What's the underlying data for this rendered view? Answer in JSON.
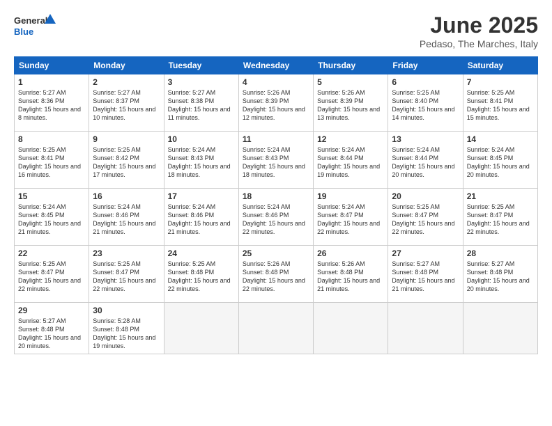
{
  "logo": {
    "line1": "General",
    "line2": "Blue"
  },
  "header": {
    "title": "June 2025",
    "subtitle": "Pedaso, The Marches, Italy"
  },
  "weekdays": [
    "Sunday",
    "Monday",
    "Tuesday",
    "Wednesday",
    "Thursday",
    "Friday",
    "Saturday"
  ],
  "weeks": [
    [
      {
        "day": "1",
        "sunrise": "Sunrise: 5:27 AM",
        "sunset": "Sunset: 8:36 PM",
        "daylight": "Daylight: 15 hours and 8 minutes."
      },
      {
        "day": "2",
        "sunrise": "Sunrise: 5:27 AM",
        "sunset": "Sunset: 8:37 PM",
        "daylight": "Daylight: 15 hours and 10 minutes."
      },
      {
        "day": "3",
        "sunrise": "Sunrise: 5:27 AM",
        "sunset": "Sunset: 8:38 PM",
        "daylight": "Daylight: 15 hours and 11 minutes."
      },
      {
        "day": "4",
        "sunrise": "Sunrise: 5:26 AM",
        "sunset": "Sunset: 8:39 PM",
        "daylight": "Daylight: 15 hours and 12 minutes."
      },
      {
        "day": "5",
        "sunrise": "Sunrise: 5:26 AM",
        "sunset": "Sunset: 8:39 PM",
        "daylight": "Daylight: 15 hours and 13 minutes."
      },
      {
        "day": "6",
        "sunrise": "Sunrise: 5:25 AM",
        "sunset": "Sunset: 8:40 PM",
        "daylight": "Daylight: 15 hours and 14 minutes."
      },
      {
        "day": "7",
        "sunrise": "Sunrise: 5:25 AM",
        "sunset": "Sunset: 8:41 PM",
        "daylight": "Daylight: 15 hours and 15 minutes."
      }
    ],
    [
      {
        "day": "8",
        "sunrise": "Sunrise: 5:25 AM",
        "sunset": "Sunset: 8:41 PM",
        "daylight": "Daylight: 15 hours and 16 minutes."
      },
      {
        "day": "9",
        "sunrise": "Sunrise: 5:25 AM",
        "sunset": "Sunset: 8:42 PM",
        "daylight": "Daylight: 15 hours and 17 minutes."
      },
      {
        "day": "10",
        "sunrise": "Sunrise: 5:24 AM",
        "sunset": "Sunset: 8:43 PM",
        "daylight": "Daylight: 15 hours and 18 minutes."
      },
      {
        "day": "11",
        "sunrise": "Sunrise: 5:24 AM",
        "sunset": "Sunset: 8:43 PM",
        "daylight": "Daylight: 15 hours and 18 minutes."
      },
      {
        "day": "12",
        "sunrise": "Sunrise: 5:24 AM",
        "sunset": "Sunset: 8:44 PM",
        "daylight": "Daylight: 15 hours and 19 minutes."
      },
      {
        "day": "13",
        "sunrise": "Sunrise: 5:24 AM",
        "sunset": "Sunset: 8:44 PM",
        "daylight": "Daylight: 15 hours and 20 minutes."
      },
      {
        "day": "14",
        "sunrise": "Sunrise: 5:24 AM",
        "sunset": "Sunset: 8:45 PM",
        "daylight": "Daylight: 15 hours and 20 minutes."
      }
    ],
    [
      {
        "day": "15",
        "sunrise": "Sunrise: 5:24 AM",
        "sunset": "Sunset: 8:45 PM",
        "daylight": "Daylight: 15 hours and 21 minutes."
      },
      {
        "day": "16",
        "sunrise": "Sunrise: 5:24 AM",
        "sunset": "Sunset: 8:46 PM",
        "daylight": "Daylight: 15 hours and 21 minutes."
      },
      {
        "day": "17",
        "sunrise": "Sunrise: 5:24 AM",
        "sunset": "Sunset: 8:46 PM",
        "daylight": "Daylight: 15 hours and 21 minutes."
      },
      {
        "day": "18",
        "sunrise": "Sunrise: 5:24 AM",
        "sunset": "Sunset: 8:46 PM",
        "daylight": "Daylight: 15 hours and 22 minutes."
      },
      {
        "day": "19",
        "sunrise": "Sunrise: 5:24 AM",
        "sunset": "Sunset: 8:47 PM",
        "daylight": "Daylight: 15 hours and 22 minutes."
      },
      {
        "day": "20",
        "sunrise": "Sunrise: 5:25 AM",
        "sunset": "Sunset: 8:47 PM",
        "daylight": "Daylight: 15 hours and 22 minutes."
      },
      {
        "day": "21",
        "sunrise": "Sunrise: 5:25 AM",
        "sunset": "Sunset: 8:47 PM",
        "daylight": "Daylight: 15 hours and 22 minutes."
      }
    ],
    [
      {
        "day": "22",
        "sunrise": "Sunrise: 5:25 AM",
        "sunset": "Sunset: 8:47 PM",
        "daylight": "Daylight: 15 hours and 22 minutes."
      },
      {
        "day": "23",
        "sunrise": "Sunrise: 5:25 AM",
        "sunset": "Sunset: 8:47 PM",
        "daylight": "Daylight: 15 hours and 22 minutes."
      },
      {
        "day": "24",
        "sunrise": "Sunrise: 5:25 AM",
        "sunset": "Sunset: 8:48 PM",
        "daylight": "Daylight: 15 hours and 22 minutes."
      },
      {
        "day": "25",
        "sunrise": "Sunrise: 5:26 AM",
        "sunset": "Sunset: 8:48 PM",
        "daylight": "Daylight: 15 hours and 22 minutes."
      },
      {
        "day": "26",
        "sunrise": "Sunrise: 5:26 AM",
        "sunset": "Sunset: 8:48 PM",
        "daylight": "Daylight: 15 hours and 21 minutes."
      },
      {
        "day": "27",
        "sunrise": "Sunrise: 5:27 AM",
        "sunset": "Sunset: 8:48 PM",
        "daylight": "Daylight: 15 hours and 21 minutes."
      },
      {
        "day": "28",
        "sunrise": "Sunrise: 5:27 AM",
        "sunset": "Sunset: 8:48 PM",
        "daylight": "Daylight: 15 hours and 20 minutes."
      }
    ],
    [
      {
        "day": "29",
        "sunrise": "Sunrise: 5:27 AM",
        "sunset": "Sunset: 8:48 PM",
        "daylight": "Daylight: 15 hours and 20 minutes."
      },
      {
        "day": "30",
        "sunrise": "Sunrise: 5:28 AM",
        "sunset": "Sunset: 8:48 PM",
        "daylight": "Daylight: 15 hours and 19 minutes."
      },
      null,
      null,
      null,
      null,
      null
    ]
  ]
}
